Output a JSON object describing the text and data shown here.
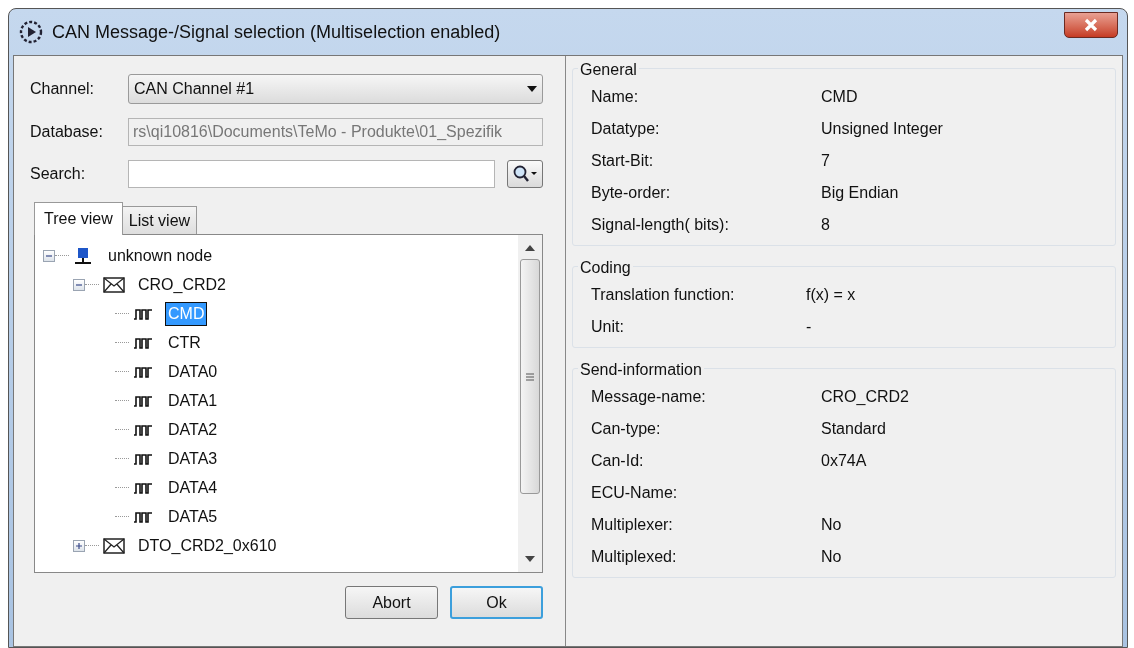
{
  "window": {
    "title": "CAN Message-/Signal selection (Multiselection enabled)"
  },
  "channel": {
    "label": "Channel:",
    "value": "CAN Channel #1"
  },
  "database": {
    "label": "Database:",
    "value": "rs\\qi10816\\Documents\\TeMo - Produkte\\01_Spezifik",
    "disabled": true
  },
  "search": {
    "label": "Search:"
  },
  "tabs": [
    {
      "label": "Tree view",
      "selected": true
    },
    {
      "label": "List view",
      "selected": false
    }
  ],
  "tree": [
    {
      "label": "unknown node",
      "kind": "node",
      "expanded": true,
      "selected": false,
      "children": [
        {
          "label": "CRO_CRD2",
          "kind": "message",
          "expanded": true,
          "selected": false,
          "children": [
            {
              "label": "CMD",
              "kind": "signal",
              "selected": true
            },
            {
              "label": "CTR",
              "kind": "signal",
              "selected": false
            },
            {
              "label": "DATA0",
              "kind": "signal",
              "selected": false
            },
            {
              "label": "DATA1",
              "kind": "signal",
              "selected": false
            },
            {
              "label": "DATA2",
              "kind": "signal",
              "selected": false
            },
            {
              "label": "DATA3",
              "kind": "signal",
              "selected": false
            },
            {
              "label": "DATA4",
              "kind": "signal",
              "selected": false
            },
            {
              "label": "DATA5",
              "kind": "signal",
              "selected": false
            }
          ]
        },
        {
          "label": "DTO_CRD2_0x610",
          "kind": "message",
          "expanded": false,
          "selected": false
        }
      ]
    }
  ],
  "buttons": [
    {
      "label": "Abort",
      "default": false
    },
    {
      "label": "Ok",
      "default": true
    }
  ],
  "sections": [
    {
      "title": "General",
      "rows": [
        {
          "label": "Name:",
          "value": "CMD"
        },
        {
          "label": "Datatype:",
          "value": "Unsigned Integer"
        },
        {
          "label": "Start-Bit:",
          "value": "7"
        },
        {
          "label": "Byte-order:",
          "value": "Big Endian"
        },
        {
          "label": "Signal-length( bits):",
          "value": "8"
        }
      ]
    },
    {
      "title": "Coding",
      "rows": [
        {
          "label": "Translation function:",
          "value": "f(x) = x"
        },
        {
          "label": "Unit:",
          "value": "-"
        }
      ]
    },
    {
      "title": "Send-information",
      "rows": [
        {
          "label": "Message-name:",
          "value": "CRO_CRD2"
        },
        {
          "label": "Can-type:",
          "value": "Standard"
        },
        {
          "label": "Can-Id:",
          "value": "0x74A"
        },
        {
          "label": "ECU-Name:"
        },
        {
          "label": "Multiplexer:",
          "value": "No"
        },
        {
          "label": "Multiplexed:",
          "value": "No"
        }
      ]
    }
  ]
}
